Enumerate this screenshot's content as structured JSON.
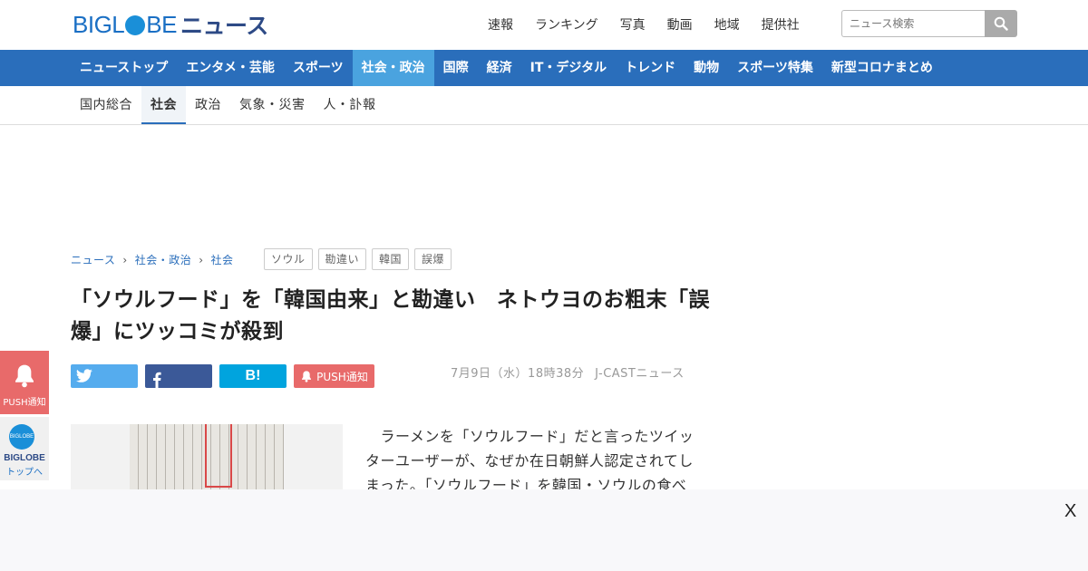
{
  "header": {
    "logo_text": "BIGLOBE",
    "logo_suffix": "ニュース",
    "top_links": [
      "速報",
      "ランキング",
      "写真",
      "動画",
      "地域",
      "提供社"
    ],
    "search_placeholder": "ニュース検索"
  },
  "main_nav": {
    "items": [
      "ニューストップ",
      "エンタメ・芸能",
      "スポーツ",
      "社会・政治",
      "国際",
      "経済",
      "IT・デジタル",
      "トレンド",
      "動物",
      "スポーツ特集",
      "新型コロナまとめ"
    ],
    "active": "社会・政治"
  },
  "sub_nav": {
    "items": [
      "国内総合",
      "社会",
      "政治",
      "気象・災害",
      "人・訃報"
    ],
    "active": "社会"
  },
  "breadcrumb": [
    "ニュース",
    "社会・政治",
    "社会"
  ],
  "tags": [
    "ソウル",
    "勘違い",
    "韓国",
    "誤爆"
  ],
  "article": {
    "title": "「ソウルフード」を「韓国由来」と勘違い　ネトウヨのお粗末「誤爆」にツッコミが殺到",
    "date": "7月9日（水）18時38分",
    "source": "J-CASTニュース",
    "body": "　ラーメンを「ソウルフード」だと言ったツイッターユーザーが、なぜか在日朝鮮人認定されてしまった。「ソウルフード」を韓国・ソウルの食べ"
  },
  "share": {
    "push_label": "PUSH通知",
    "hatena_label": "B!"
  },
  "side_float": {
    "push_label": "PUSH通知",
    "top_label1": "BIGLOBE",
    "top_label2": "トップへ",
    "top_badge": "BIGLOBE"
  },
  "ad": {
    "close_label": "X"
  },
  "colors": {
    "brand_blue": "#2a6ebb",
    "active_tab": "#4aa3df",
    "twitter": "#55acee",
    "facebook": "#3b5998",
    "hatena": "#00a4de",
    "push": "#e86a6a"
  }
}
